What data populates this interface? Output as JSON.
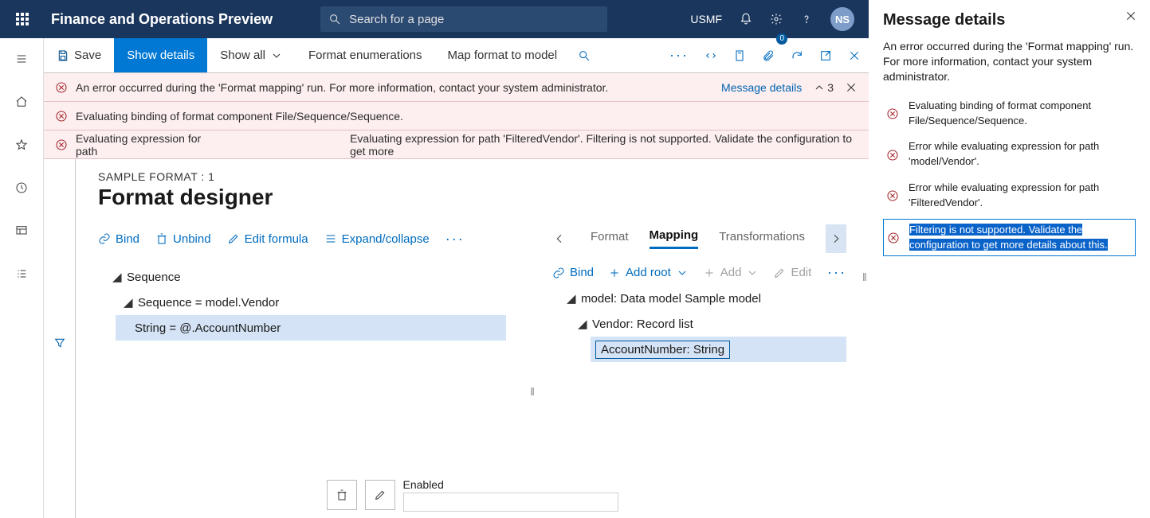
{
  "topbar": {
    "app_title": "Finance and Operations Preview",
    "search_placeholder": "Search for a page",
    "company": "USMF",
    "avatar": "NS"
  },
  "actionbar": {
    "save": "Save",
    "show_details": "Show details",
    "show_all": "Show all",
    "format_enum": "Format enumerations",
    "map_format": "Map format to model",
    "badge": "0"
  },
  "banners": [
    {
      "text": "An error occurred during the 'Format mapping' run. For more information, contact your system administrator.",
      "link": "Message details",
      "count": "3"
    },
    {
      "text": "Evaluating binding of format component File/Sequence/Sequence."
    },
    {
      "text": "Evaluating expression for path",
      "text2": "Evaluating expression for path 'FilteredVendor'. Filtering is not supported. Validate the configuration to get more"
    }
  ],
  "designer": {
    "crumb": "SAMPLE FORMAT : 1",
    "title": "Format designer",
    "left_tools": {
      "bind": "Bind",
      "unbind": "Unbind",
      "edit_formula": "Edit formula",
      "expand": "Expand/collapse"
    },
    "tabs": {
      "format": "Format",
      "mapping": "Mapping",
      "transformations": "Transformations"
    },
    "left_tree": {
      "n1": "Sequence",
      "n2": "Sequence = model.Vendor",
      "n3": "String = @.AccountNumber"
    },
    "right_tools": {
      "bind": "Bind",
      "add_root": "Add root",
      "add": "Add",
      "edit": "Edit"
    },
    "right_tree": {
      "n1": "model: Data model Sample model",
      "n2": "Vendor: Record list",
      "n3": "AccountNumber: String"
    },
    "enabled_label": "Enabled"
  },
  "panel": {
    "title": "Message details",
    "desc": "An error occurred during the 'Format mapping' run. For more information, contact your system administrator.",
    "items": [
      "Evaluating binding of format component File/Sequence/Sequence.",
      "Error while evaluating expression for path 'model/Vendor'.",
      "Error while evaluating expression for path 'FilteredVendor'.",
      "Filtering is not supported. Validate the configuration to get more details about this."
    ]
  }
}
